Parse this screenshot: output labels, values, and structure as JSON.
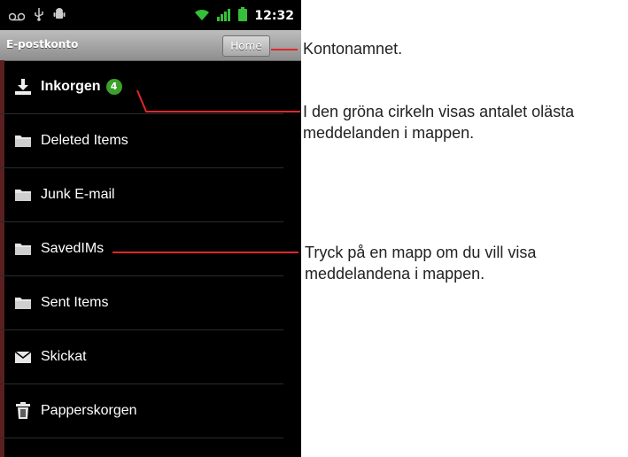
{
  "status_bar": {
    "time": "12:32",
    "icons": [
      "voicemail-icon",
      "usb-icon",
      "android-debug-icon",
      "wifi-icon",
      "signal-icon",
      "battery-icon"
    ]
  },
  "header": {
    "title": "E-postkonto",
    "home_label": "Home"
  },
  "folders": [
    {
      "name": "Inkorgen",
      "icon": "inbox-download-icon",
      "unread": "4",
      "bold": true
    },
    {
      "name": "Deleted Items",
      "icon": "folder-icon"
    },
    {
      "name": "Junk E-mail",
      "icon": "folder-icon"
    },
    {
      "name": "SavedIMs",
      "icon": "folder-icon"
    },
    {
      "name": "Sent Items",
      "icon": "folder-icon"
    },
    {
      "name": "Skickat",
      "icon": "sent-mail-icon"
    },
    {
      "name": "Papperskorgen",
      "icon": "trash-icon"
    }
  ],
  "annotations": {
    "account_name": "Kontonamnet.",
    "unread_count_line1": "I den gröna cirkeln visas antalet olästa",
    "unread_count_line2": "meddelanden i mappen.",
    "open_folder_line1": "Tryck på en mapp om du vill visa",
    "open_folder_line2": "meddelandena i mappen."
  },
  "colors": {
    "badge": "#3aa02a",
    "callout_line": "#e0262a"
  }
}
